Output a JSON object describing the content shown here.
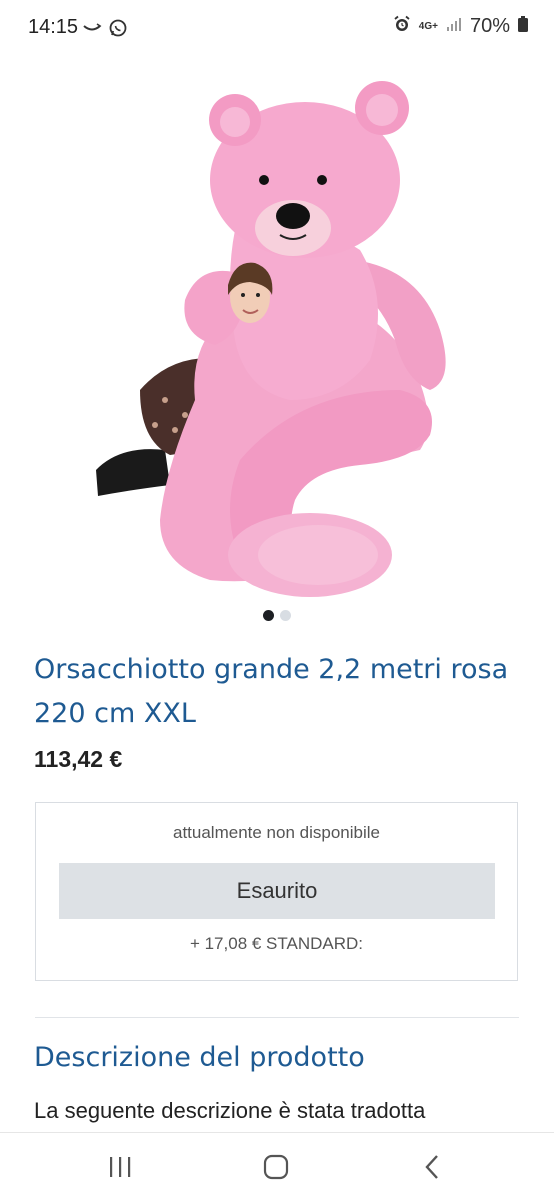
{
  "status_bar": {
    "time": "14:15",
    "network": "4G+",
    "battery": "70%"
  },
  "product": {
    "image_alt": "Orsacchiotto rosa gigante",
    "carousel_total": 2,
    "carousel_active": 1,
    "title": "Orsacchiotto grande 2,2 metri rosa 220 cm XXL",
    "price": "113,42 €"
  },
  "buybox": {
    "availability": "attualmente non disponibile",
    "button_label": "Esaurito",
    "shipping": "+ 17,08 € STANDARD:"
  },
  "description": {
    "heading": "Descrizione del prodotto",
    "text": "La seguente descrizione è stata tradotta"
  },
  "colors": {
    "accent": "#1e5a92",
    "button_bg": "#dde1e5",
    "bear_pink": "#f4a7cb"
  },
  "icons": {
    "nav_left": "recent-apps-icon",
    "nav_center": "home-icon",
    "nav_right": "back-icon"
  }
}
